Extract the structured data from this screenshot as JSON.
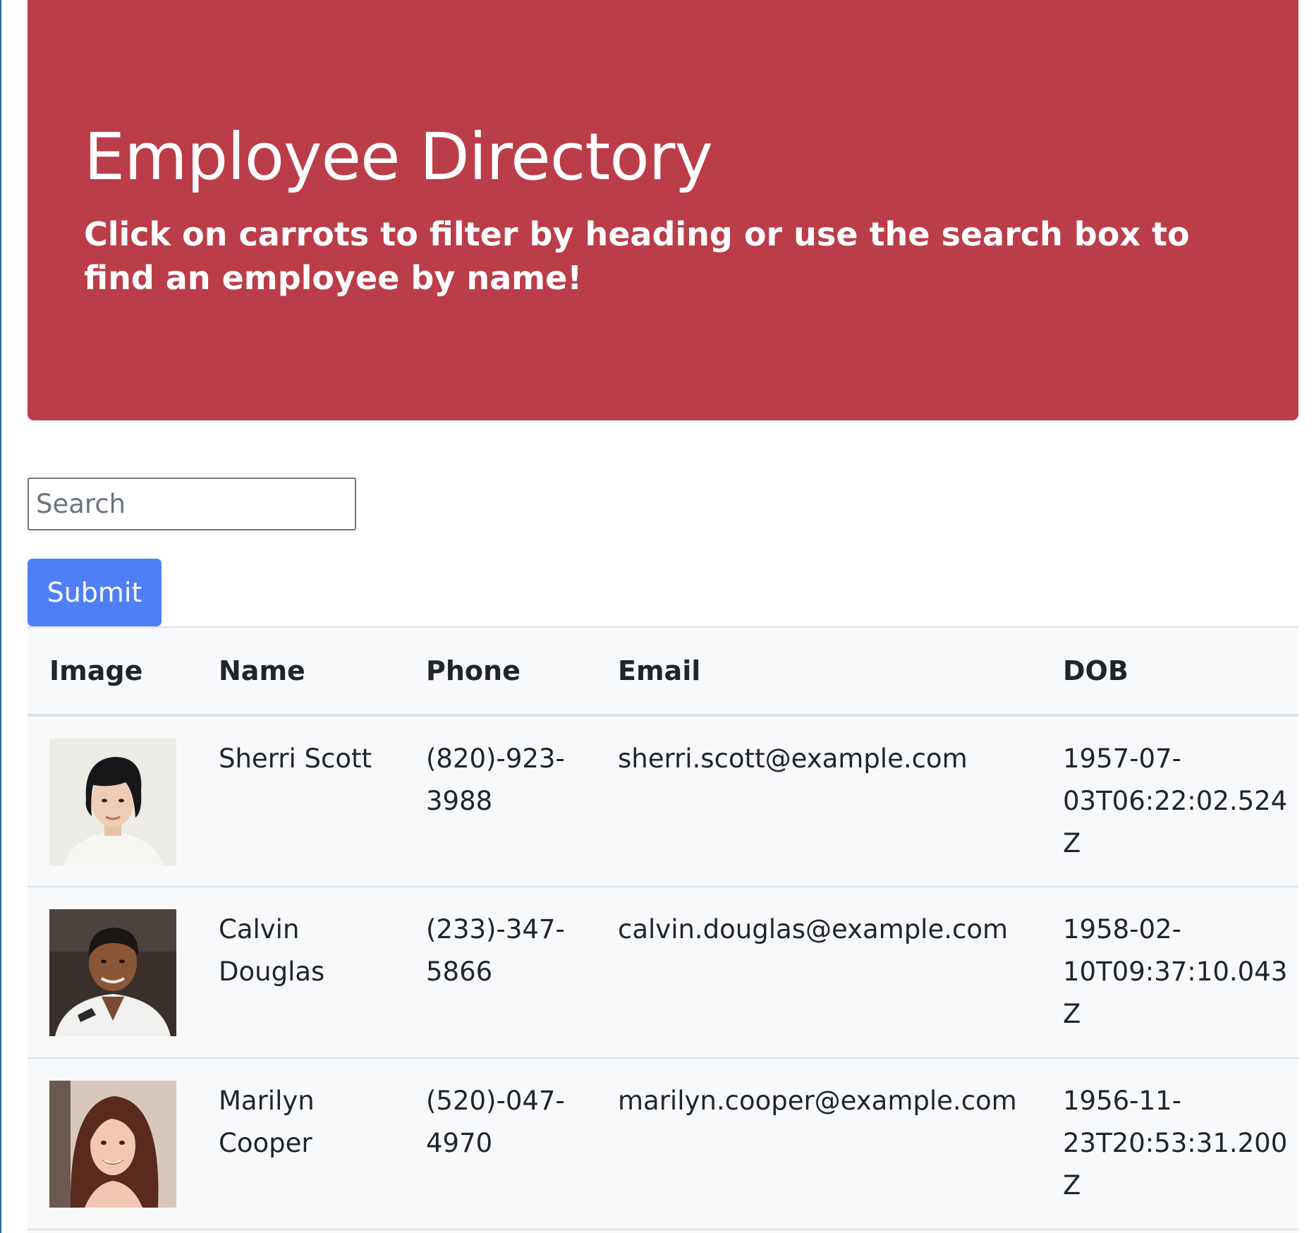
{
  "header": {
    "title": "Employee Directory",
    "subtitle": "Click on carrots to filter by heading or use the search box to find an employee by name!"
  },
  "search": {
    "placeholder": "Search",
    "value": ""
  },
  "submit_label": "Submit",
  "table": {
    "columns": [
      "Image",
      "Name",
      "Phone",
      "Email",
      "DOB"
    ],
    "rows": [
      {
        "avatar": "employee-photo-woman-short-dark-hair",
        "name": "Sherri Scott",
        "phone": "(820)-923-3988",
        "email": "sherri.scott@example.com",
        "dob": "1957-07-03T06:22:02.524Z"
      },
      {
        "avatar": "employee-photo-man-dark-hair",
        "name": "Calvin Douglas",
        "phone": "(233)-347-5866",
        "email": "calvin.douglas@example.com",
        "dob": "1958-02-10T09:37:10.043Z"
      },
      {
        "avatar": "employee-photo-woman-long-brown-hair",
        "name": "Marilyn Cooper",
        "phone": "(520)-047-4970",
        "email": "marilyn.cooper@example.com",
        "dob": "1956-11-23T20:53:31.200Z"
      }
    ]
  },
  "colors": {
    "header_background": "#bb3d49",
    "button_background": "#4f7ef7",
    "table_background": "#f8f9fa"
  }
}
